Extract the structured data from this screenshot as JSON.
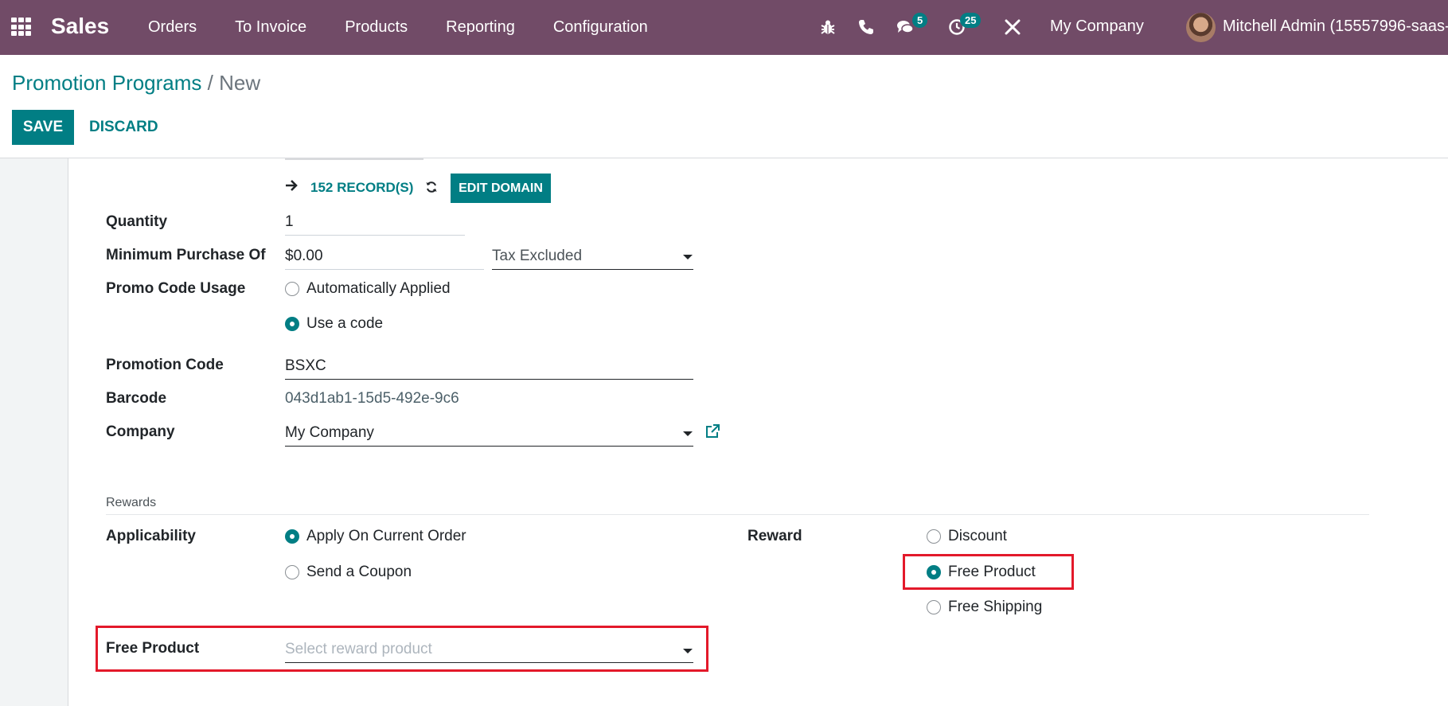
{
  "navbar": {
    "app_name": "Sales",
    "menu": [
      "Orders",
      "To Invoice",
      "Products",
      "Reporting",
      "Configuration"
    ],
    "icons": [
      "apps-grid-icon",
      "bug-icon",
      "phone-icon",
      "chat-icon",
      "activity-clock-icon",
      "tools-icon"
    ],
    "messages_badge": "5",
    "activities_badge": "25",
    "company": "My Company",
    "user": "Mitchell Admin (15557996-saas-"
  },
  "breadcrumb": {
    "parent": "Promotion Programs",
    "separator": "/",
    "current": "New"
  },
  "buttons": {
    "save": "SAVE",
    "discard": "DISCARD",
    "edit_domain": "EDIT DOMAIN"
  },
  "form": {
    "records": "152 RECORD(S)",
    "quantity": {
      "label": "Quantity",
      "value": "1"
    },
    "minimum_purchase": {
      "label": "Minimum Purchase Of",
      "value": "$0.00",
      "tax_option": "Tax Excluded"
    },
    "promo_code_usage": {
      "label": "Promo Code Usage",
      "options": [
        {
          "label": "Automatically Applied",
          "checked": false
        },
        {
          "label": "Use a code",
          "checked": true
        }
      ]
    },
    "promotion_code": {
      "label": "Promotion Code",
      "value": "BSXC"
    },
    "barcode": {
      "label": "Barcode",
      "value": "043d1ab1-15d5-492e-9c6"
    },
    "company": {
      "label": "Company",
      "value": "My Company"
    }
  },
  "rewards": {
    "section_title": "Rewards",
    "applicability": {
      "label": "Applicability",
      "options": [
        {
          "label": "Apply On Current Order",
          "checked": true
        },
        {
          "label": "Send a Coupon",
          "checked": false
        }
      ]
    },
    "reward": {
      "label": "Reward",
      "options": [
        {
          "label": "Discount",
          "checked": false
        },
        {
          "label": "Free Product",
          "checked": true
        },
        {
          "label": "Free Shipping",
          "checked": false
        }
      ]
    },
    "free_product": {
      "label": "Free Product",
      "placeholder": "Select reward product"
    }
  },
  "colors": {
    "navbar": "#714b67",
    "primary": "#017e84",
    "highlight": "#e3192a"
  }
}
